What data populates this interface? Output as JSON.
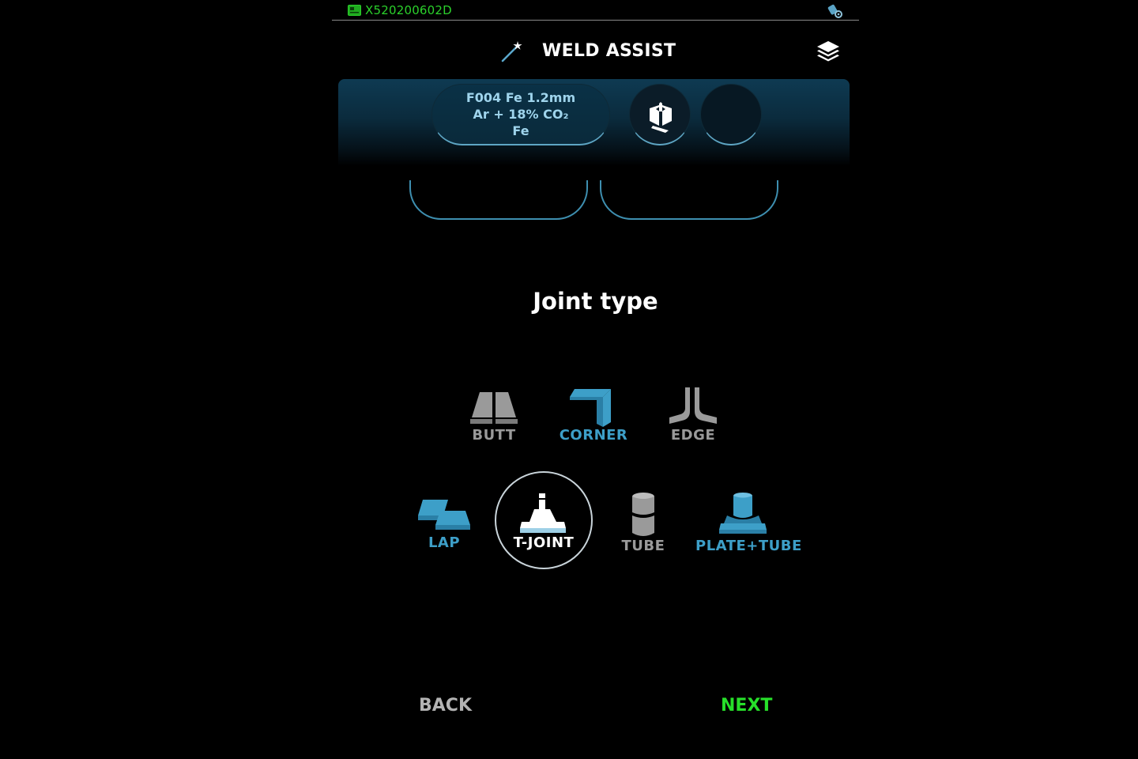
{
  "status_bar": {
    "device_id": "X520200602D",
    "device_icon": "card-icon",
    "right_icon": "gear-badge-icon"
  },
  "header": {
    "title": "WELD ASSIST",
    "left_icon": "magic-wand-icon",
    "right_icon": "layers-icon"
  },
  "config": {
    "wire_line1": "F004 Fe 1.2mm",
    "wire_line2": "Ar + 18% CO₂",
    "wire_line3": "Fe",
    "torch_icon": "torch-icon"
  },
  "joint_section": {
    "title": "Joint type",
    "options": [
      {
        "label": "BUTT",
        "state": "unavailable",
        "icon": "butt-joint-icon"
      },
      {
        "label": "CORNER",
        "state": "available",
        "icon": "corner-joint-icon"
      },
      {
        "label": "EDGE",
        "state": "unavailable",
        "icon": "edge-joint-icon"
      },
      {
        "label": "LAP",
        "state": "available",
        "icon": "lap-joint-icon"
      },
      {
        "label": "T-JOINT",
        "state": "selected",
        "icon": "t-joint-icon"
      },
      {
        "label": "TUBE",
        "state": "unavailable",
        "icon": "tube-joint-icon"
      },
      {
        "label": "PLATE+TUBE",
        "state": "available",
        "icon": "plate-tube-joint-icon"
      }
    ]
  },
  "footer": {
    "back_label": "BACK",
    "next_label": "NEXT"
  },
  "colors": {
    "accent_blue": "#3d9fc8",
    "unavailable_grey": "#9a9a9a",
    "next_green": "#27e02a",
    "status_green": "#2bd12b"
  }
}
